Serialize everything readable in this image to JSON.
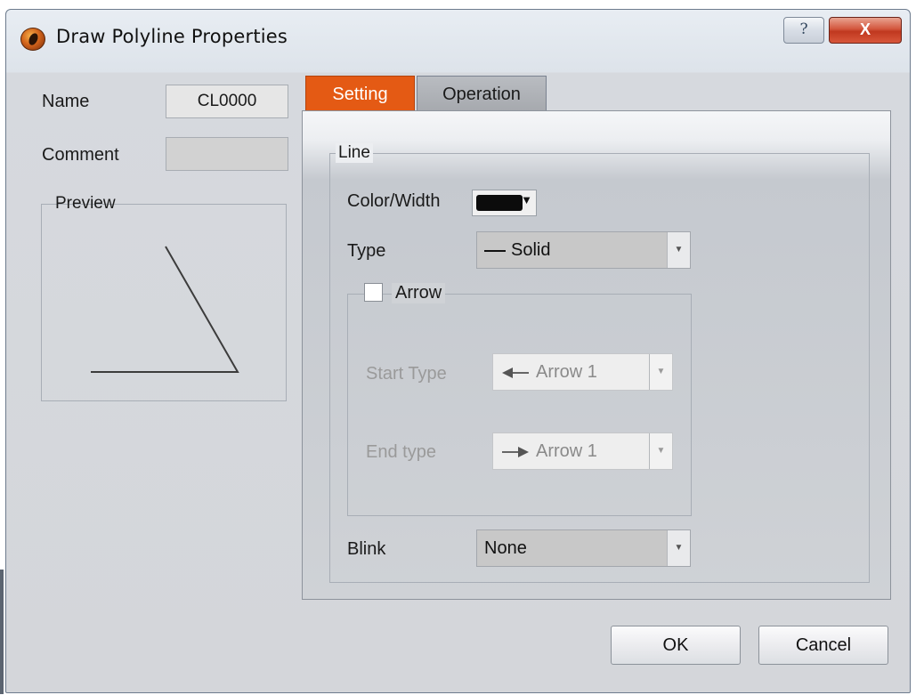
{
  "window": {
    "title": "Draw Polyline Properties",
    "help_label": "?",
    "close_label": "X"
  },
  "general": {
    "name_label": "Name",
    "name_value": "CL0000",
    "comment_label": "Comment",
    "comment_value": "",
    "preview_label": "Preview"
  },
  "tabs": [
    {
      "label": "Setting",
      "active": true
    },
    {
      "label": "Operation",
      "active": false
    }
  ],
  "line": {
    "group_label": "Line",
    "color_width_label": "Color/Width",
    "color": "#0c0c0c",
    "type_label": "Type",
    "type_value": "Solid"
  },
  "arrow": {
    "group_label": "Arrow",
    "enabled": false,
    "start_type_label": "Start Type",
    "start_type_value": "Arrow 1",
    "end_type_label": "End type",
    "end_type_value": "Arrow 1"
  },
  "blink": {
    "label": "Blink",
    "value": "None"
  },
  "buttons": {
    "ok": "OK",
    "cancel": "Cancel"
  },
  "colors": {
    "active_tab": "#e45a14"
  }
}
